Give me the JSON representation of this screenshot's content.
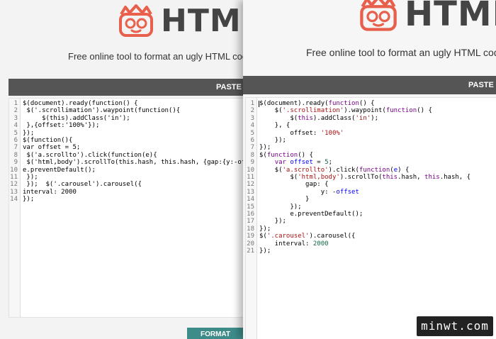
{
  "left_window": {
    "logo_text": "HTML",
    "tagline": "Free online tool to format an ugly HTML code, m",
    "paste_bar_label": "PASTE Y",
    "format_button": "FORMAT",
    "code_lines": [
      [
        {
          "t": "$(document).ready(function() {",
          "c": ""
        }
      ],
      [
        {
          "t": " $('.scrollimation').waypoint(function(){",
          "c": ""
        }
      ],
      [
        {
          "t": "     $(this).addClass('in');",
          "c": ""
        }
      ],
      [
        {
          "t": " },{offset:'100%'});",
          "c": ""
        }
      ],
      [
        {
          "t": "});",
          "c": ""
        }
      ],
      [
        {
          "t": "$(function(){",
          "c": ""
        }
      ],
      [
        {
          "t": "var offset = 5;",
          "c": ""
        }
      ],
      [
        {
          "t": " $('a.scrollto').click(function(e){",
          "c": ""
        }
      ],
      [
        {
          "t": " $('html,body').scrollTo(this.hash, this.hash, {gap:{y:-offset}});",
          "c": ""
        }
      ],
      [
        {
          "t": "e.preventDefault();",
          "c": ""
        }
      ],
      [
        {
          "t": " });",
          "c": ""
        }
      ],
      [
        {
          "t": " });  $('.carousel').carousel({",
          "c": ""
        }
      ],
      [
        {
          "t": "interval: 2000",
          "c": ""
        }
      ],
      [
        {
          "t": "});",
          "c": ""
        }
      ]
    ]
  },
  "right_window": {
    "logo_text": "HTML",
    "tagline": "Free online tool to format an ugly HTML code, m",
    "paste_bar_label": "PASTE Y",
    "code_lines": [
      [
        {
          "t": "$(document).ready(",
          "c": ""
        },
        {
          "t": "function",
          "c": "kw"
        },
        {
          "t": "() {",
          "c": ""
        }
      ],
      [
        {
          "t": "    $(",
          "c": ""
        },
        {
          "t": "'.scrollimation'",
          "c": "str"
        },
        {
          "t": ").waypoint(",
          "c": ""
        },
        {
          "t": "function",
          "c": "kw"
        },
        {
          "t": "() {",
          "c": ""
        }
      ],
      [
        {
          "t": "        $(",
          "c": ""
        },
        {
          "t": "this",
          "c": "kw"
        },
        {
          "t": ").addClass(",
          "c": ""
        },
        {
          "t": "'in'",
          "c": "str"
        },
        {
          "t": ");",
          "c": ""
        }
      ],
      [
        {
          "t": "    }, {",
          "c": ""
        }
      ],
      [
        {
          "t": "        offset: ",
          "c": ""
        },
        {
          "t": "'100%'",
          "c": "str"
        }
      ],
      [
        {
          "t": "    });",
          "c": ""
        }
      ],
      [
        {
          "t": "});",
          "c": ""
        }
      ],
      [
        {
          "t": "$(",
          "c": ""
        },
        {
          "t": "function",
          "c": "kw"
        },
        {
          "t": "() {",
          "c": ""
        }
      ],
      [
        {
          "t": "    ",
          "c": ""
        },
        {
          "t": "var",
          "c": "kw"
        },
        {
          "t": " ",
          "c": ""
        },
        {
          "t": "offset",
          "c": "var"
        },
        {
          "t": " = ",
          "c": ""
        },
        {
          "t": "5",
          "c": "num"
        },
        {
          "t": ";",
          "c": ""
        }
      ],
      [
        {
          "t": "    $(",
          "c": ""
        },
        {
          "t": "'a.scrollto'",
          "c": "str"
        },
        {
          "t": ").click(",
          "c": ""
        },
        {
          "t": "function",
          "c": "kw"
        },
        {
          "t": "(",
          "c": ""
        },
        {
          "t": "e",
          "c": "var"
        },
        {
          "t": ") {",
          "c": ""
        }
      ],
      [
        {
          "t": "        $(",
          "c": ""
        },
        {
          "t": "'html,body'",
          "c": "str"
        },
        {
          "t": ").scrollTo(",
          "c": ""
        },
        {
          "t": "this",
          "c": "kw"
        },
        {
          "t": ".hash, ",
          "c": ""
        },
        {
          "t": "this",
          "c": "kw"
        },
        {
          "t": ".hash, {",
          "c": ""
        }
      ],
      [
        {
          "t": "            gap: {",
          "c": ""
        }
      ],
      [
        {
          "t": "                y: -",
          "c": ""
        },
        {
          "t": "offset",
          "c": "var"
        }
      ],
      [
        {
          "t": "            }",
          "c": ""
        }
      ],
      [
        {
          "t": "        });",
          "c": ""
        }
      ],
      [
        {
          "t": "        e.preventDefault();",
          "c": ""
        }
      ],
      [
        {
          "t": "    });",
          "c": ""
        }
      ],
      [
        {
          "t": "});",
          "c": ""
        }
      ],
      [
        {
          "t": "$(",
          "c": ""
        },
        {
          "t": "'.carousel'",
          "c": "str"
        },
        {
          "t": ").carousel({",
          "c": ""
        }
      ],
      [
        {
          "t": "    interval: ",
          "c": ""
        },
        {
          "t": "2000",
          "c": "num"
        }
      ],
      [
        {
          "t": "});",
          "c": ""
        }
      ]
    ]
  },
  "watermark": "minwt.com",
  "colors": {
    "logo_orange": "#e8604c",
    "bar_gray": "#555555",
    "format_teal": "#3e8c8a"
  }
}
